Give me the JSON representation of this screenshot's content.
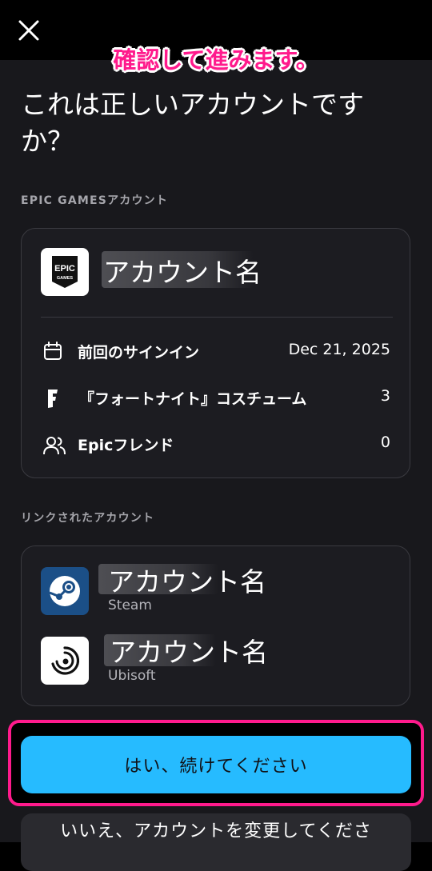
{
  "annotation": "確認して進みます。",
  "heading": "これは正しいアカウントですか？",
  "epic_section": {
    "label": "EPIC GAMESアカウント",
    "logo_text_top": "EPIC",
    "logo_text_bottom": "GAMES",
    "account_name": "アカウント名",
    "rows": [
      {
        "icon": "calendar-icon",
        "label": "前回のサインイン",
        "value": "Dec 21, 2025"
      },
      {
        "icon": "fortnite-icon",
        "label": "『フォートナイト』コスチューム",
        "value": "3"
      },
      {
        "icon": "friends-icon",
        "label": "Epicフレンド",
        "value": "0"
      }
    ]
  },
  "linked_section": {
    "label": "リンクされたアカウント",
    "accounts": [
      {
        "icon": "steam-icon",
        "name": "アカウント名",
        "platform": "Steam"
      },
      {
        "icon": "ubisoft-icon",
        "name": "アカウント名",
        "platform": "Ubisoft"
      }
    ]
  },
  "buttons": {
    "confirm": "はい、続けてください",
    "change": "いいえ、アカウントを変更してくださ"
  },
  "colors": {
    "accent": "#26bbff",
    "annotation": "#ff1a8c",
    "background": "#18181c"
  }
}
